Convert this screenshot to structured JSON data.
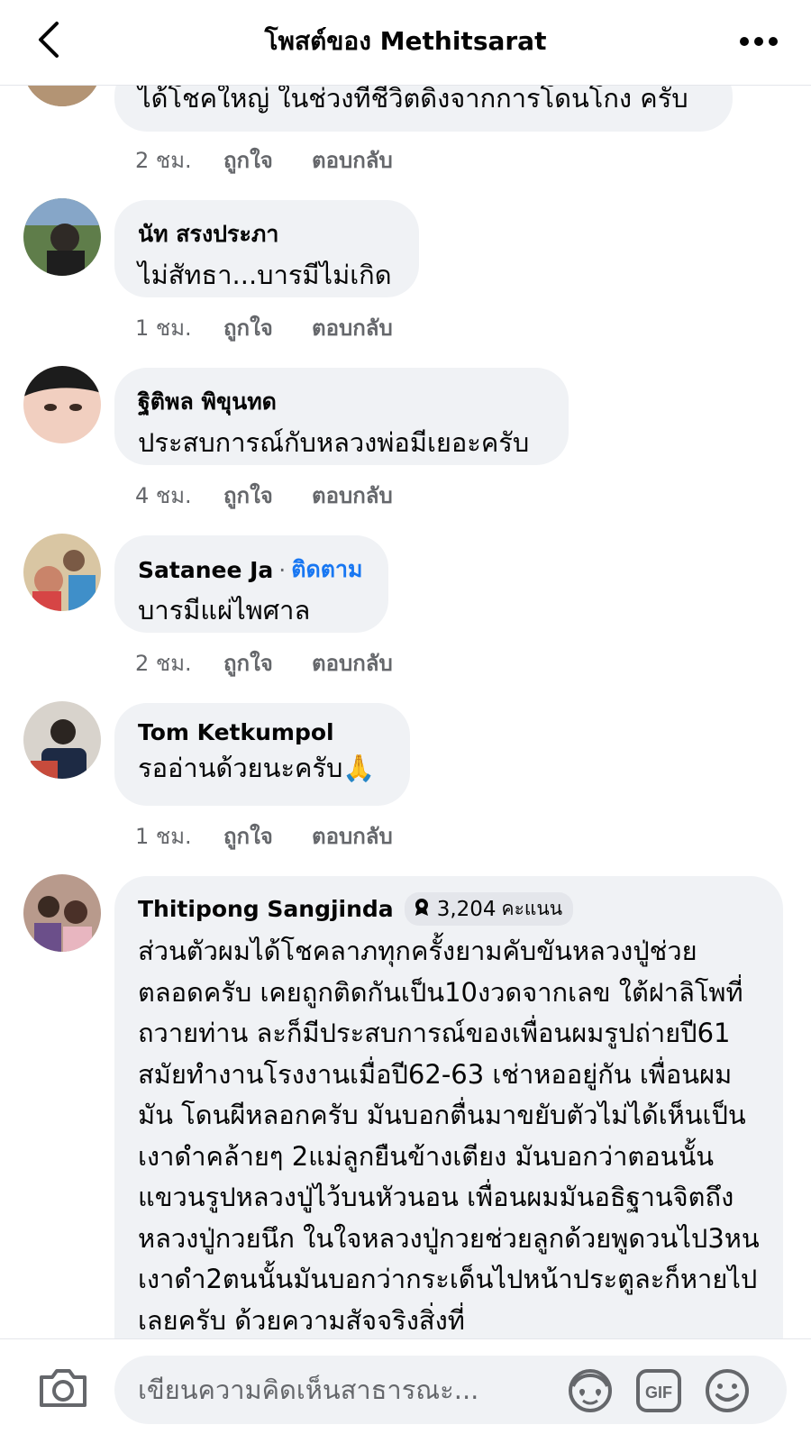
{
  "header": {
    "title": "โพสต์ของ Methitsarat"
  },
  "comments": [
    {
      "author": "",
      "text": "ได้โชคใหญ่ ในช่วงทีชีวิตดิ่งจากการโดนโกง ครับ",
      "time": "2 ชม.",
      "like": "ถูกใจ",
      "reply": "ตอบกลับ"
    },
    {
      "author": "นัท สรงประภา",
      "text": "ไม่สัทธา...บารมีไม่เกิด",
      "time": "1 ชม.",
      "like": "ถูกใจ",
      "reply": "ตอบกลับ"
    },
    {
      "author": "ฐิติพล พิขุนทด",
      "text": "ประสบการณ์กับหลวงพ่อมีเยอะครับ",
      "time": "4 ชม.",
      "like": "ถูกใจ",
      "reply": "ตอบกลับ"
    },
    {
      "author": "Satanee Ja",
      "follow": "ติดตาม",
      "separator": "·",
      "text": "บารมีแผ่ไพศาล",
      "time": "2 ชม.",
      "like": "ถูกใจ",
      "reply": "ตอบกลับ"
    },
    {
      "author": "Tom Ketkumpol",
      "text": "รออ่านด้วยนะครับ🙏",
      "time": "1 ชม.",
      "like": "ถูกใจ",
      "reply": "ตอบกลับ"
    },
    {
      "author": "Thitipong Sangjinda",
      "badge_points": "3,204",
      "badge_unit": "คะแนน",
      "text": "ส่วนตัวผมได้โชคลาภทุกครั้งยามคับขันหลวงปู่ช่วยตลอดครับ เคยถูกติดกันเป็น10งวดจากเลข ใต้ฝาลิโพที่ถวายท่าน ละก็มีประสบการณ์ของเพื่อนผมรูปถ่ายปี61 สมัยทำงานโรงงานเมื่อปี62-63 เช่าหออยู่กัน เพื่อนผมมัน โดนผีหลอกครับ มันบอกตื่นมาขยับตัวไม่ได้เห็นเป็นเงาดำคล้ายๆ 2แม่ลูกยืนข้างเตียง มันบอกว่าตอนนั้นแขวนรูปหลวงปู่ไว้บนหัวนอน เพื่อนผมมันอธิฐานจิตถึงหลวงปู่กวยนึก ในใจหลวงปู่กวยช่วยลูกด้วยพูดวนไป3หน เงาดำ2ตนนั้นมันบอกว่ากระเด็นไปหน้าประตูละก็หายไปเลยครับ ด้วยความสัจจริงสิ่งที่"
    }
  ],
  "composer": {
    "placeholder": "เขียนความคิดเห็นสาธารณะ...",
    "icons": [
      "camera-icon",
      "avatar-sticker-icon",
      "gif-icon",
      "emoji-icon"
    ],
    "gif_label": "GIF"
  },
  "colors": {
    "bubble": "#f0f2f5",
    "link_blue": "#1877f2",
    "meta_gray": "#65676b",
    "text": "#050505"
  }
}
